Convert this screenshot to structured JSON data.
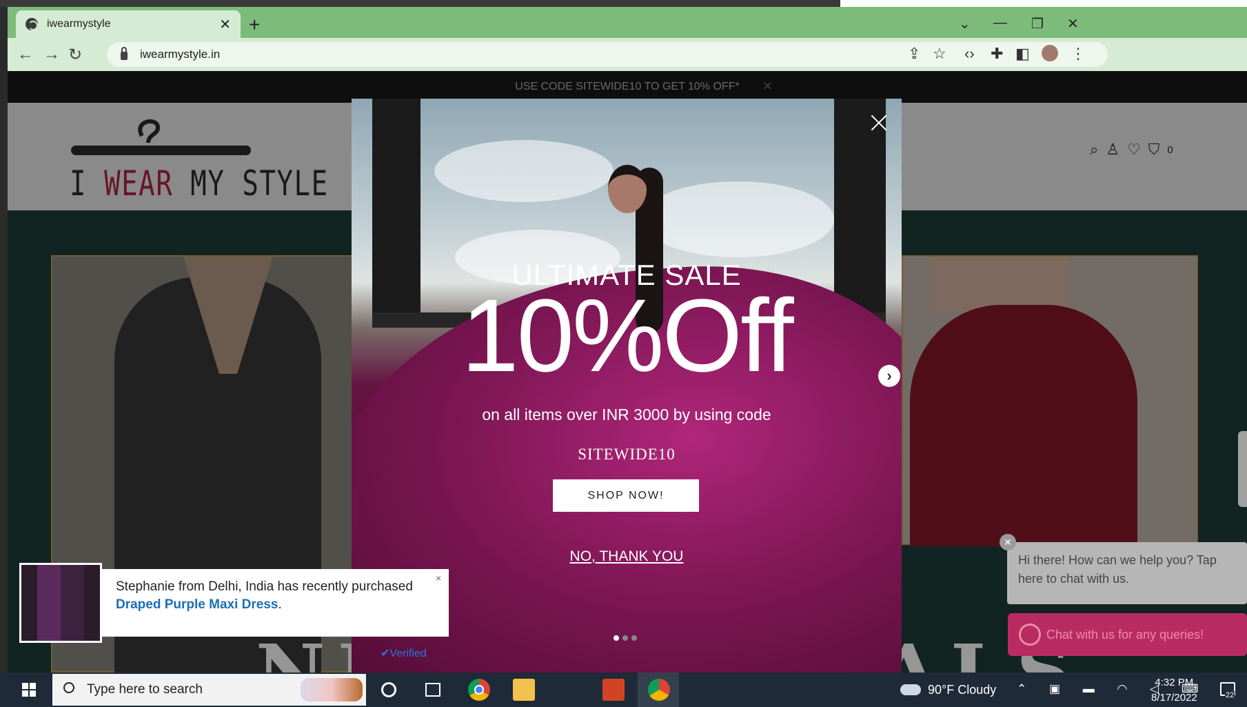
{
  "browser": {
    "tab_title": "iwearmystyle",
    "tab_close": "✕",
    "new_tab": "+",
    "url": "iwearmystyle.in",
    "window_controls": [
      "⌄",
      "—",
      "❐",
      "✕"
    ]
  },
  "site": {
    "announcement": "USE CODE SITEWIDE10 TO GET 10% OFF*",
    "announcement_close": "✕",
    "logo": {
      "line_i": "I ",
      "line_wear": "WEAR",
      "line_rest": " MY STYLE"
    },
    "cart_count": "0",
    "hero_heading": "NEW ARRIVALS",
    "colors": {
      "brand": "#8a1d33",
      "chat": "#b82c61",
      "link": "#1a6eb8"
    }
  },
  "popup": {
    "eyebrow": "ULTIMATE SALE",
    "headline": "10%Off",
    "subline": "on all items over INR 3000 by using code",
    "code": "SITEWIDE10",
    "cta": "SHOP NOW!",
    "decline": "NO, THANK YOU",
    "next_icon": "›",
    "slide_count": 3,
    "active_slide": 1
  },
  "toast": {
    "text_before": "Stephanie from Delhi, India has recently purchased ",
    "product": "Draped Purple Maxi Dress",
    "text_after": ".",
    "verified": "✔Verified",
    "close": "×"
  },
  "chat": {
    "bubble": "Hi there! How can we help you? Tap here to chat with us.",
    "bubble_close": "✕",
    "button": "Chat with us for any queries!"
  },
  "taskbar": {
    "search_placeholder": "Type here to search",
    "weather": "90°F  Cloudy",
    "time": "4:32 PM",
    "date": "8/17/2022",
    "notifications": "22"
  }
}
